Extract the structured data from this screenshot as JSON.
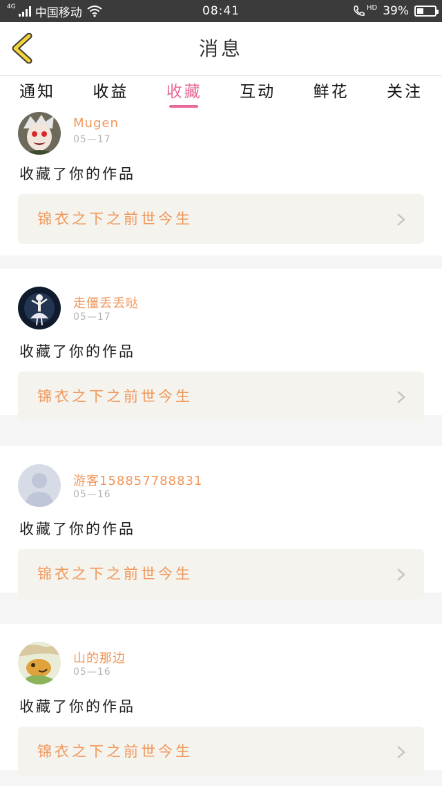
{
  "status_bar": {
    "network": "4G",
    "carrier": "中国移动",
    "time": "08:41",
    "hd_label": "HD",
    "battery": "39%",
    "battery_level": 0.39
  },
  "header": {
    "title": "消息"
  },
  "tabs": [
    {
      "label": "通知",
      "active": false
    },
    {
      "label": "收益",
      "active": false
    },
    {
      "label": "收藏",
      "active": true
    },
    {
      "label": "互动",
      "active": false
    },
    {
      "label": "鲜花",
      "active": false
    },
    {
      "label": "关注",
      "active": false
    }
  ],
  "notifications": [
    {
      "username": "Mugen",
      "date": "05—17",
      "action": "收藏了你的作品",
      "work_title": "锦衣之下之前世今生",
      "avatar_icon": "anime-avatar"
    },
    {
      "username": "走僵丢丢哒",
      "date": "05—17",
      "action": "收藏了你的作品",
      "work_title": "锦衣之下之前世今生",
      "avatar_icon": "dancer-avatar"
    },
    {
      "username": "游客158857788831",
      "date": "05—16",
      "action": "收藏了你的作品",
      "work_title": "锦衣之下之前世今生",
      "avatar_icon": "default-user-avatar"
    },
    {
      "username": "山的那边",
      "date": "05—16",
      "action": "收藏了你的作品",
      "work_title": "锦衣之下之前世今生",
      "avatar_icon": "cartoon-avatar"
    }
  ],
  "colors": {
    "accent": "#e96a9a",
    "username": "#f0975a",
    "status_bar_bg": "#3b3b3b"
  }
}
